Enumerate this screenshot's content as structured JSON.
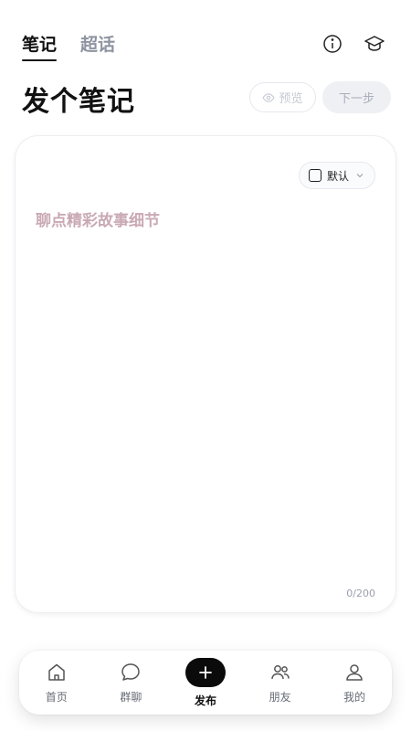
{
  "tabs": [
    {
      "label": "笔记",
      "active": true
    },
    {
      "label": "超话",
      "active": false
    }
  ],
  "top_icons": [
    "info-icon",
    "graduation-cap-icon"
  ],
  "page_title": "发个笔记",
  "buttons": {
    "preview_label": "预览",
    "next_label": "下一步"
  },
  "editor": {
    "visibility_label": "默认",
    "placeholder": "聊点精彩故事细节",
    "char_count": "0/200"
  },
  "bottom_nav": [
    {
      "label": "首页",
      "icon": "home-icon"
    },
    {
      "label": "群聊",
      "icon": "chat-bubble-icon"
    },
    {
      "label": "发布",
      "icon": "plus-icon"
    },
    {
      "label": "朋友",
      "icon": "friends-icon"
    },
    {
      "label": "我的",
      "icon": "profile-icon"
    }
  ],
  "colors": {
    "accent": "#0b0b0b",
    "placeholder": "#c9a9b4",
    "muted": "#8d93a0"
  }
}
